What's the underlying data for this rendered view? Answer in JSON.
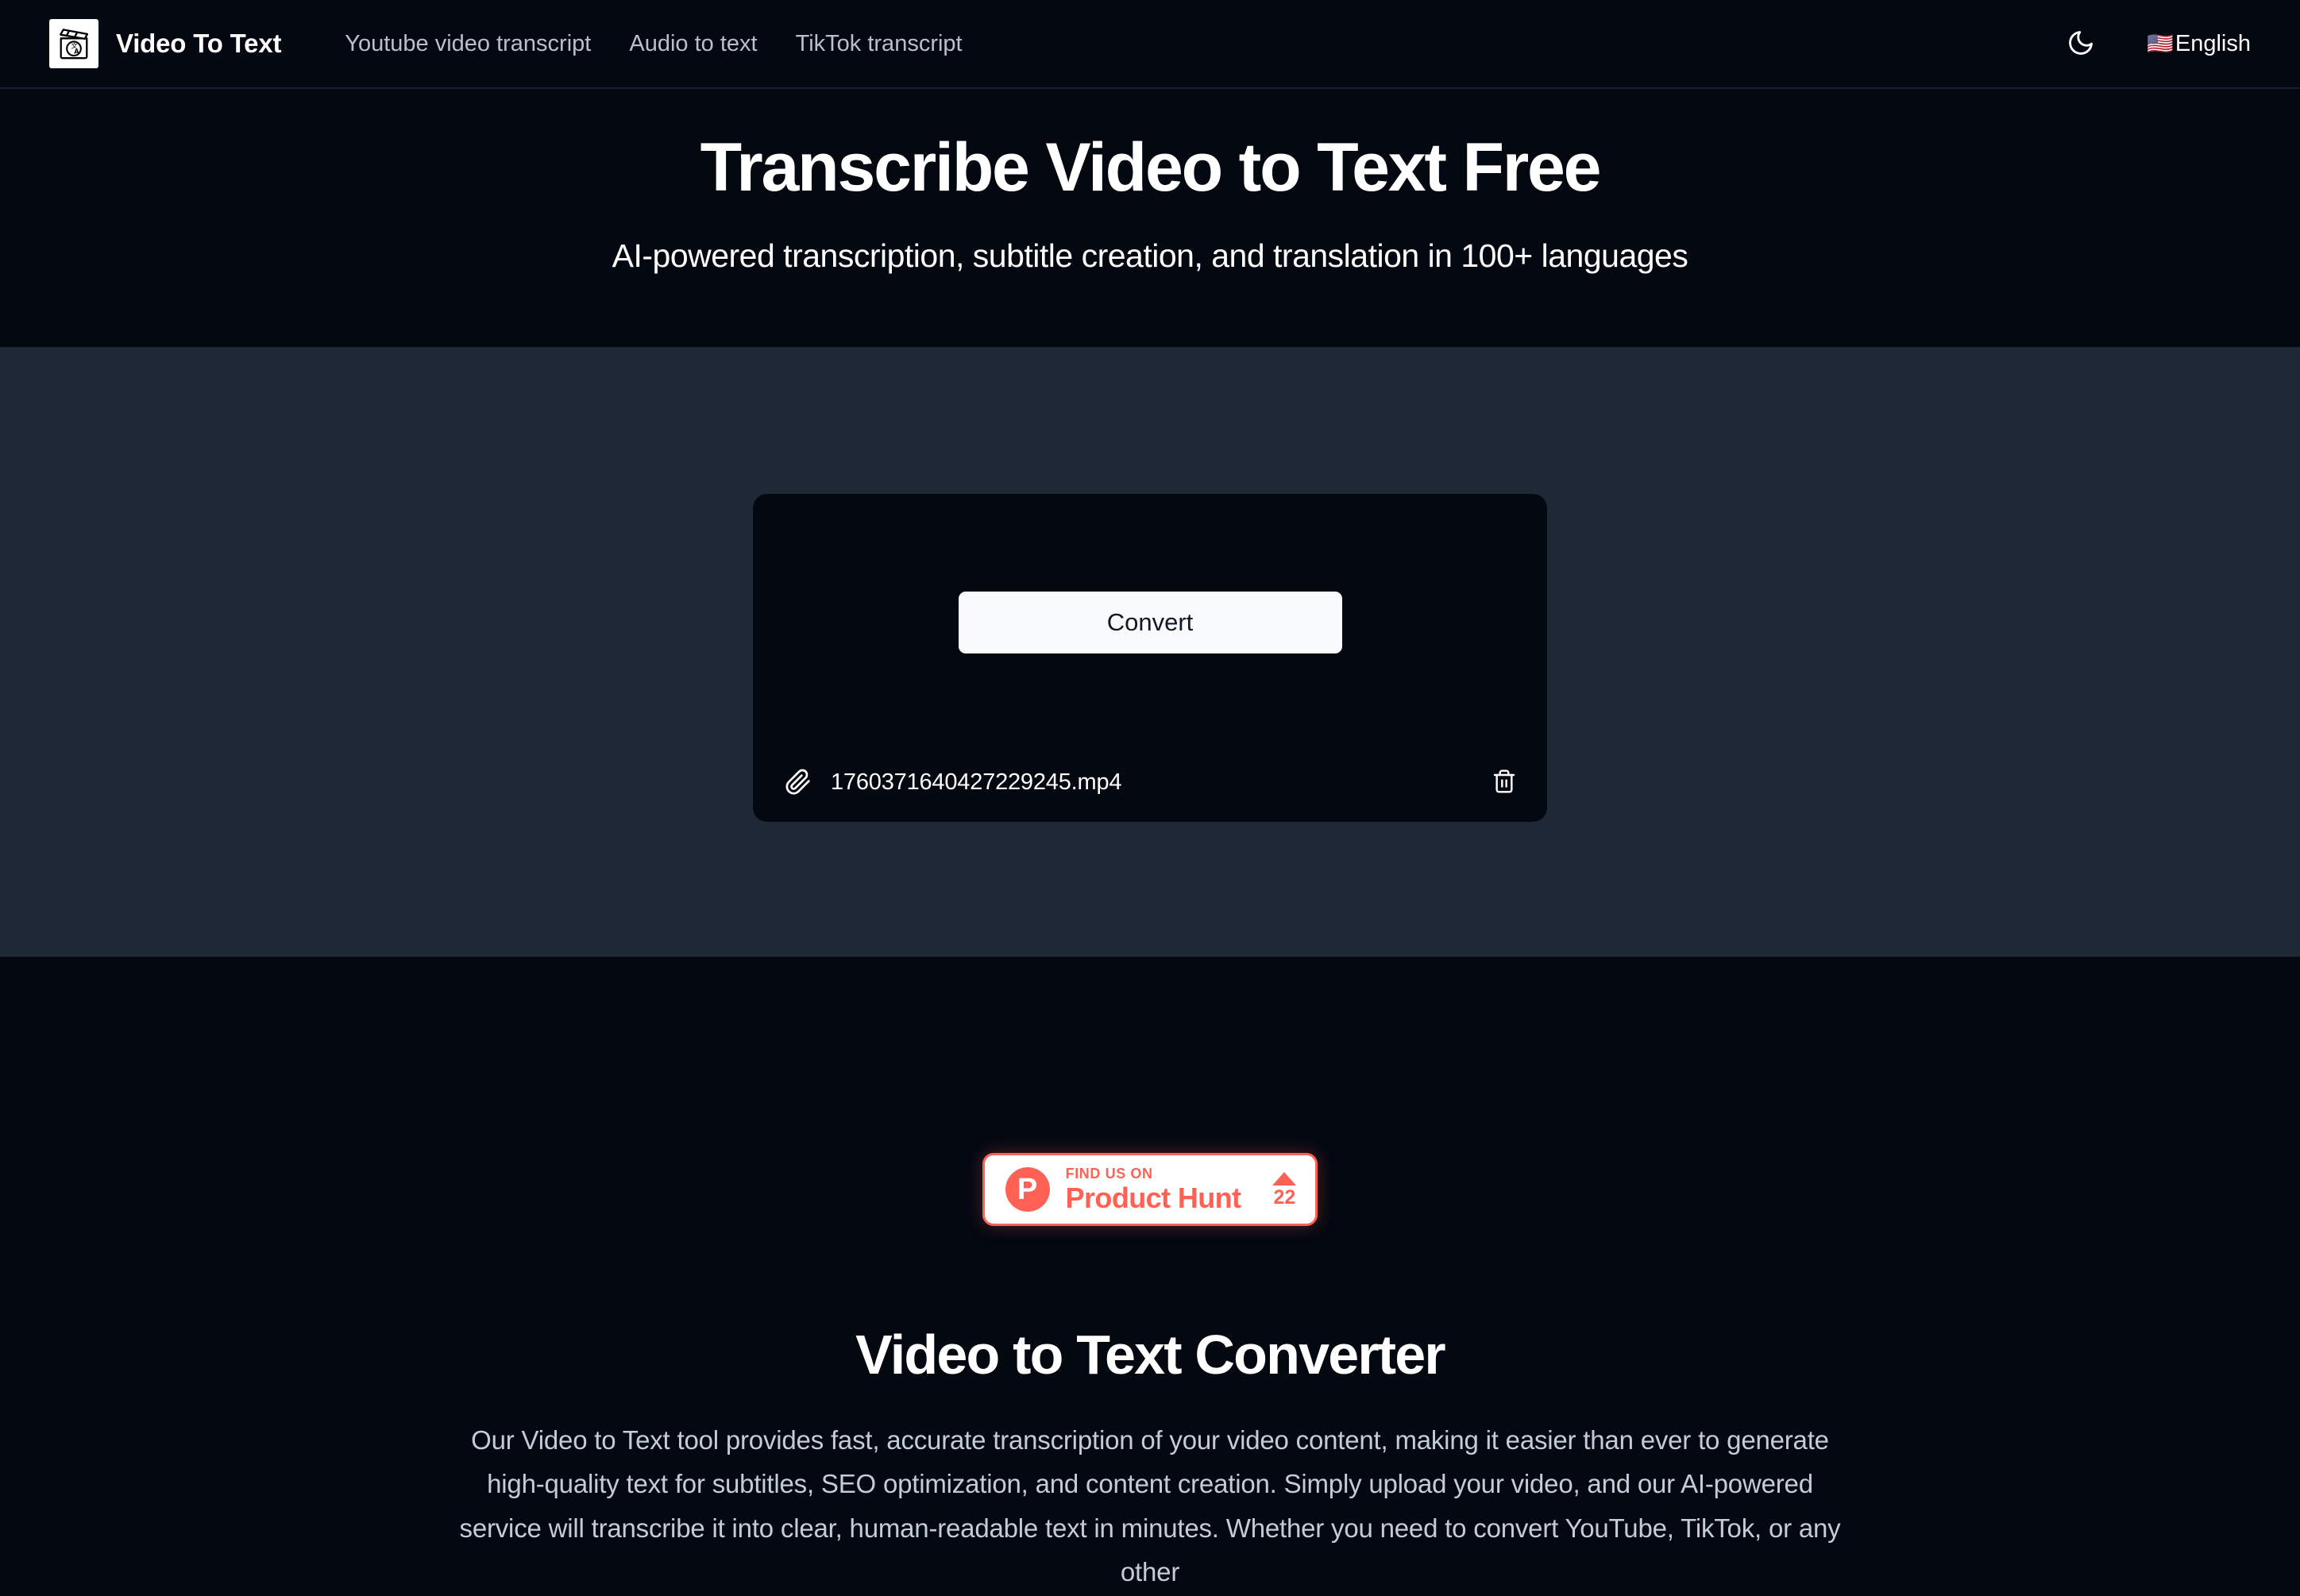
{
  "header": {
    "brand_name": "Video To Text",
    "logo_icon": "clapperboard-translate-icon",
    "nav": [
      {
        "label": "Youtube video transcript"
      },
      {
        "label": "Audio to text"
      },
      {
        "label": "TikTok transcript"
      }
    ],
    "theme_toggle_icon": "moon-icon",
    "language": {
      "flag": "🇺🇸",
      "label": "English"
    }
  },
  "hero": {
    "title": "Transcribe Video to Text Free",
    "subtitle": "AI-powered transcription, subtitle creation, and translation in 100+ languages"
  },
  "converter": {
    "convert_label": "Convert",
    "file": {
      "attach_icon": "paperclip-icon",
      "name": "1760371640427229245.mp4",
      "delete_icon": "trash-icon"
    }
  },
  "product_hunt": {
    "logo_letter": "P",
    "kicker": "FIND US ON",
    "name": "Product Hunt",
    "upvote_icon": "triangle-up-icon",
    "votes": "22"
  },
  "info": {
    "title": "Video to Text Converter",
    "paragraph": "Our Video to Text tool provides fast, accurate transcription of your video content, making it easier than ever to generate high-quality text for subtitles, SEO optimization, and content creation. Simply upload your video, and our AI-powered service will transcribe it into clear, human-readable text in minutes. Whether you need to convert YouTube, TikTok, or any other"
  },
  "colors": {
    "page_background": "#030811",
    "section_background": "#1f2837",
    "card_background": "#030811",
    "button_background": "#f8fafc",
    "accent": "#ff6154",
    "muted_text": "#c3ccd8"
  }
}
